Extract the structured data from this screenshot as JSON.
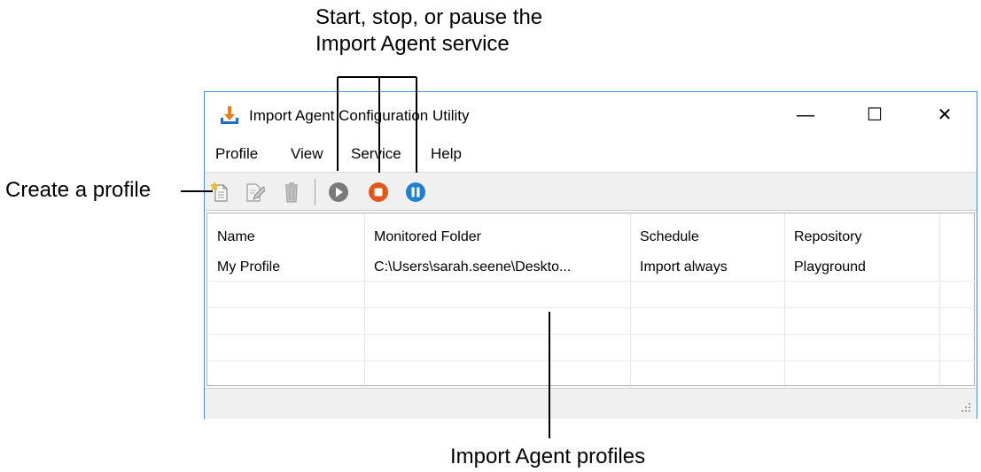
{
  "callouts": {
    "service_line1": "Start, stop, or pause the",
    "service_line2": "Import Agent service",
    "create_profile": "Create a profile",
    "profiles": "Import Agent profiles"
  },
  "window": {
    "title": "Import Agent Configuration Utility",
    "minimize_glyph": "—",
    "maximize_glyph": "☐",
    "close_glyph": "✕"
  },
  "menu": [
    "Profile",
    "View",
    "Service",
    "Help"
  ],
  "toolbar": {
    "icons": [
      "new-profile-icon",
      "edit-profile-icon",
      "delete-profile-icon",
      "start-service-icon",
      "stop-service-icon",
      "pause-service-icon"
    ],
    "colors": {
      "start": "#7a7a7a",
      "stop": "#e2561b",
      "pause": "#1f7fd6"
    }
  },
  "table": {
    "columns": [
      "Name",
      "Monitored Folder",
      "Schedule",
      "Repository"
    ],
    "rows": [
      [
        "My Profile",
        "C:\\Users\\sarah.seene\\Deskto...",
        "Import always",
        "Playground"
      ]
    ]
  }
}
